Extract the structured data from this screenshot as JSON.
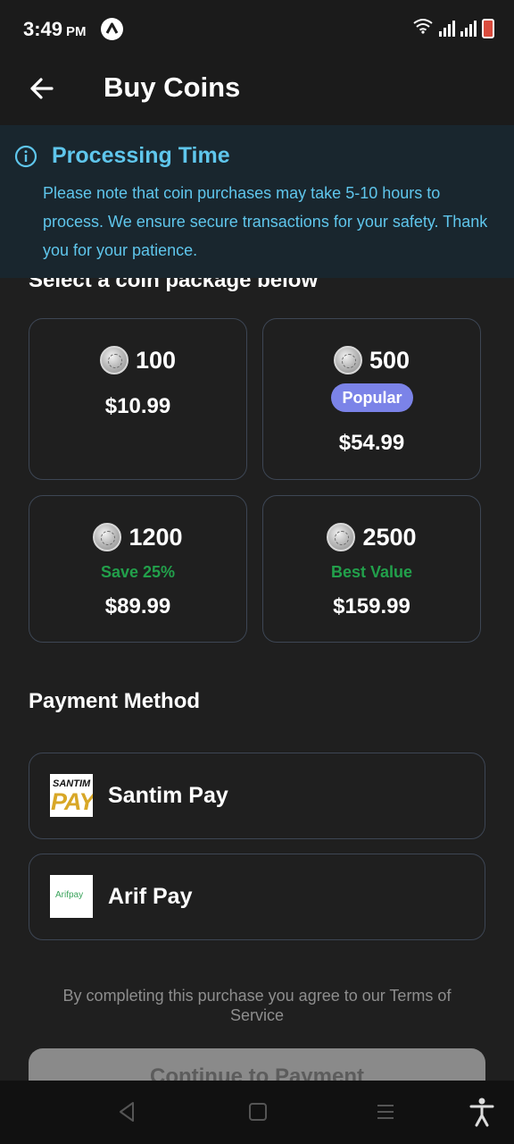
{
  "status_bar": {
    "time": "3:49",
    "ampm": "PM",
    "icons": [
      "app-notification-icon",
      "wifi-icon",
      "signal-icon",
      "signal-icon",
      "battery-icon"
    ]
  },
  "header": {
    "back_icon": "arrow-left-icon",
    "title": "Buy Coins"
  },
  "notice": {
    "icon": "info-icon",
    "title": "Processing Time",
    "body": "Please note that coin purchases may take 5-10 hours to process. We ensure secure transactions for your safety. Thank you for your patience."
  },
  "packages": {
    "label": "Select a coin package below",
    "items": [
      {
        "coins": "100",
        "price": "$10.99",
        "tag": ""
      },
      {
        "coins": "500",
        "price": "$54.99",
        "tag": "Popular"
      },
      {
        "coins": "1200",
        "price": "$89.99",
        "tag": "Save 25%"
      },
      {
        "coins": "2500",
        "price": "$159.99",
        "tag": "Best Value"
      }
    ]
  },
  "payment": {
    "label": "Payment Method",
    "methods": [
      {
        "name": "Santim Pay",
        "logo_top": "SANTIM",
        "logo_main": "PAY"
      },
      {
        "name": "Arif Pay",
        "logo_text": "Arifpay"
      }
    ]
  },
  "terms": "By completing this purchase you agree to our Terms of Service",
  "continue_label": "Continue to Payment",
  "nav": {
    "icons": [
      "back-triangle-icon",
      "home-square-icon",
      "menu-lines-icon",
      "accessibility-icon"
    ]
  },
  "colors": {
    "background": "#1f1f1f",
    "notice_bg": "#19262e",
    "notice_text": "#5fc6ec",
    "card_border": "#3d4654",
    "popular_badge": "#7b83e8",
    "save_text": "#22a04b",
    "button_disabled": "#8a8a8a"
  }
}
